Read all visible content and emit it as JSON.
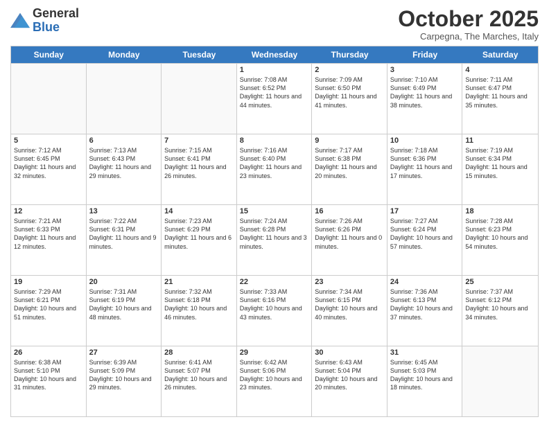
{
  "logo": {
    "general": "General",
    "blue": "Blue"
  },
  "header": {
    "month": "October 2025",
    "location": "Carpegna, The Marches, Italy"
  },
  "weekdays": [
    "Sunday",
    "Monday",
    "Tuesday",
    "Wednesday",
    "Thursday",
    "Friday",
    "Saturday"
  ],
  "weeks": [
    [
      {
        "day": "",
        "info": ""
      },
      {
        "day": "",
        "info": ""
      },
      {
        "day": "",
        "info": ""
      },
      {
        "day": "1",
        "info": "Sunrise: 7:08 AM\nSunset: 6:52 PM\nDaylight: 11 hours and 44 minutes."
      },
      {
        "day": "2",
        "info": "Sunrise: 7:09 AM\nSunset: 6:50 PM\nDaylight: 11 hours and 41 minutes."
      },
      {
        "day": "3",
        "info": "Sunrise: 7:10 AM\nSunset: 6:49 PM\nDaylight: 11 hours and 38 minutes."
      },
      {
        "day": "4",
        "info": "Sunrise: 7:11 AM\nSunset: 6:47 PM\nDaylight: 11 hours and 35 minutes."
      }
    ],
    [
      {
        "day": "5",
        "info": "Sunrise: 7:12 AM\nSunset: 6:45 PM\nDaylight: 11 hours and 32 minutes."
      },
      {
        "day": "6",
        "info": "Sunrise: 7:13 AM\nSunset: 6:43 PM\nDaylight: 11 hours and 29 minutes."
      },
      {
        "day": "7",
        "info": "Sunrise: 7:15 AM\nSunset: 6:41 PM\nDaylight: 11 hours and 26 minutes."
      },
      {
        "day": "8",
        "info": "Sunrise: 7:16 AM\nSunset: 6:40 PM\nDaylight: 11 hours and 23 minutes."
      },
      {
        "day": "9",
        "info": "Sunrise: 7:17 AM\nSunset: 6:38 PM\nDaylight: 11 hours and 20 minutes."
      },
      {
        "day": "10",
        "info": "Sunrise: 7:18 AM\nSunset: 6:36 PM\nDaylight: 11 hours and 17 minutes."
      },
      {
        "day": "11",
        "info": "Sunrise: 7:19 AM\nSunset: 6:34 PM\nDaylight: 11 hours and 15 minutes."
      }
    ],
    [
      {
        "day": "12",
        "info": "Sunrise: 7:21 AM\nSunset: 6:33 PM\nDaylight: 11 hours and 12 minutes."
      },
      {
        "day": "13",
        "info": "Sunrise: 7:22 AM\nSunset: 6:31 PM\nDaylight: 11 hours and 9 minutes."
      },
      {
        "day": "14",
        "info": "Sunrise: 7:23 AM\nSunset: 6:29 PM\nDaylight: 11 hours and 6 minutes."
      },
      {
        "day": "15",
        "info": "Sunrise: 7:24 AM\nSunset: 6:28 PM\nDaylight: 11 hours and 3 minutes."
      },
      {
        "day": "16",
        "info": "Sunrise: 7:26 AM\nSunset: 6:26 PM\nDaylight: 11 hours and 0 minutes."
      },
      {
        "day": "17",
        "info": "Sunrise: 7:27 AM\nSunset: 6:24 PM\nDaylight: 10 hours and 57 minutes."
      },
      {
        "day": "18",
        "info": "Sunrise: 7:28 AM\nSunset: 6:23 PM\nDaylight: 10 hours and 54 minutes."
      }
    ],
    [
      {
        "day": "19",
        "info": "Sunrise: 7:29 AM\nSunset: 6:21 PM\nDaylight: 10 hours and 51 minutes."
      },
      {
        "day": "20",
        "info": "Sunrise: 7:31 AM\nSunset: 6:19 PM\nDaylight: 10 hours and 48 minutes."
      },
      {
        "day": "21",
        "info": "Sunrise: 7:32 AM\nSunset: 6:18 PM\nDaylight: 10 hours and 46 minutes."
      },
      {
        "day": "22",
        "info": "Sunrise: 7:33 AM\nSunset: 6:16 PM\nDaylight: 10 hours and 43 minutes."
      },
      {
        "day": "23",
        "info": "Sunrise: 7:34 AM\nSunset: 6:15 PM\nDaylight: 10 hours and 40 minutes."
      },
      {
        "day": "24",
        "info": "Sunrise: 7:36 AM\nSunset: 6:13 PM\nDaylight: 10 hours and 37 minutes."
      },
      {
        "day": "25",
        "info": "Sunrise: 7:37 AM\nSunset: 6:12 PM\nDaylight: 10 hours and 34 minutes."
      }
    ],
    [
      {
        "day": "26",
        "info": "Sunrise: 6:38 AM\nSunset: 5:10 PM\nDaylight: 10 hours and 31 minutes."
      },
      {
        "day": "27",
        "info": "Sunrise: 6:39 AM\nSunset: 5:09 PM\nDaylight: 10 hours and 29 minutes."
      },
      {
        "day": "28",
        "info": "Sunrise: 6:41 AM\nSunset: 5:07 PM\nDaylight: 10 hours and 26 minutes."
      },
      {
        "day": "29",
        "info": "Sunrise: 6:42 AM\nSunset: 5:06 PM\nDaylight: 10 hours and 23 minutes."
      },
      {
        "day": "30",
        "info": "Sunrise: 6:43 AM\nSunset: 5:04 PM\nDaylight: 10 hours and 20 minutes."
      },
      {
        "day": "31",
        "info": "Sunrise: 6:45 AM\nSunset: 5:03 PM\nDaylight: 10 hours and 18 minutes."
      },
      {
        "day": "",
        "info": ""
      }
    ]
  ]
}
